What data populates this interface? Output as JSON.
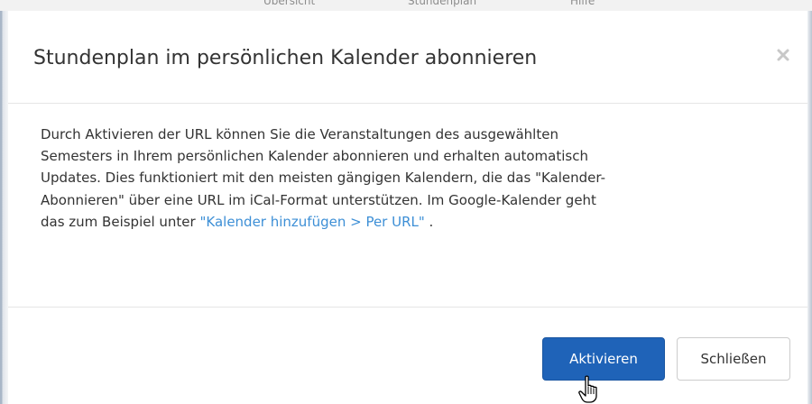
{
  "background_page": {
    "tab_fragments": [
      "Übersicht",
      "Stundenplan",
      "Hilfe"
    ]
  },
  "dialog": {
    "title": "Stundenplan im persönlichen Kalender abonnieren",
    "close_icon": "close-x-icon",
    "body": {
      "lines": [
        "Durch Aktivieren der URL können Sie die Veranstaltungen des ausgewählten",
        "Semesters in Ihrem persönlichen Kalender abonnieren und erhalten automatisch",
        "Updates. Dies funktioniert mit den meisten gängigen Kalendern, die das \"Kalender-",
        "Abonnieren\" über eine URL im iCal-Format unterstützen. Im Google-Kalender geht"
      ],
      "last_line_prefix": "das zum Beispiel unter ",
      "link_text": "\"Kalender hinzufügen > Per URL\"",
      "last_line_suffix": " ."
    },
    "buttons": {
      "activate": "Aktivieren",
      "close": "Schließen"
    },
    "cursor_icon": "hand-pointer-icon"
  },
  "colors": {
    "primary_button": "#1f63b8",
    "link": "#3d8fd6",
    "text": "#333333",
    "close_icon": "#c8c8c8"
  }
}
